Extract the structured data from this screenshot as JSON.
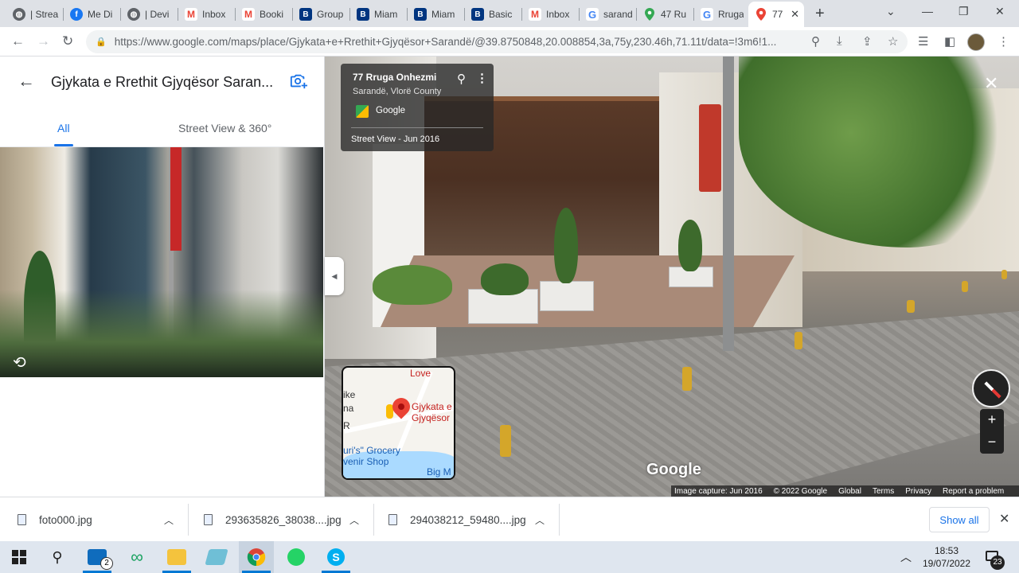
{
  "browser": {
    "tabs": [
      {
        "title": "| Strea",
        "favicon": "globe-icon"
      },
      {
        "title": "Me Di",
        "favicon": "facebook-icon"
      },
      {
        "title": "| Devi",
        "favicon": "globe-icon"
      },
      {
        "title": "Inbox",
        "favicon": "gmail-icon"
      },
      {
        "title": "Booki",
        "favicon": "gmail-icon"
      },
      {
        "title": "Group",
        "favicon": "booking-icon"
      },
      {
        "title": "Miam",
        "favicon": "booking-icon"
      },
      {
        "title": "Miam",
        "favicon": "booking-icon"
      },
      {
        "title": "Basic",
        "favicon": "booking-icon"
      },
      {
        "title": "Inbox",
        "favicon": "gmail-icon"
      },
      {
        "title": "sarand",
        "favicon": "google-icon"
      },
      {
        "title": "47 Ru",
        "favicon": "maps-icon"
      },
      {
        "title": "Rruga",
        "favicon": "google-icon"
      },
      {
        "title": "77",
        "favicon": "maps-icon",
        "active": true
      }
    ],
    "url": "https://www.google.com/maps/place/Gjykata+e+Rrethit+Gjyqësor+Sarandë/@39.8750848,20.008854,3a,75y,230.46h,71.11t/data=!3m6!1..."
  },
  "left_panel": {
    "title": "Gjykata e Rrethit Gjyqësor Saran...",
    "tabs": [
      {
        "label": "All",
        "active": true
      },
      {
        "label": "Street View & 360°",
        "active": false
      }
    ]
  },
  "street_view": {
    "info_card": {
      "address": "77 Rruga Onhezmi",
      "locality": "Sarandë, Vlorë County",
      "provider": "Google",
      "capture": "Street View - Jun 2016"
    },
    "watermark": "Google",
    "footer": [
      "Image capture: Jun 2016",
      "© 2022 Google",
      "Global",
      "Terms",
      "Privacy",
      "Report a problem"
    ],
    "minimap": {
      "labels": [
        "Love",
        "ike",
        "na",
        "Gjykata e",
        "Gjyqësor",
        "R",
        "uri's\" Grocery",
        "venir Shop",
        "Big M"
      ]
    }
  },
  "downloads": {
    "items": [
      "foto000.jpg",
      "293635826_38038....jpg",
      "294038212_59480....jpg"
    ],
    "show_all": "Show all"
  },
  "taskbar": {
    "mail_badge": "2",
    "time": "18:53",
    "date": "19/07/2022",
    "notifications": "23"
  },
  "colors": {
    "accent": "#1a73e8",
    "pin": "#ea4335",
    "taskbar_bg": "#dfe6ef"
  }
}
